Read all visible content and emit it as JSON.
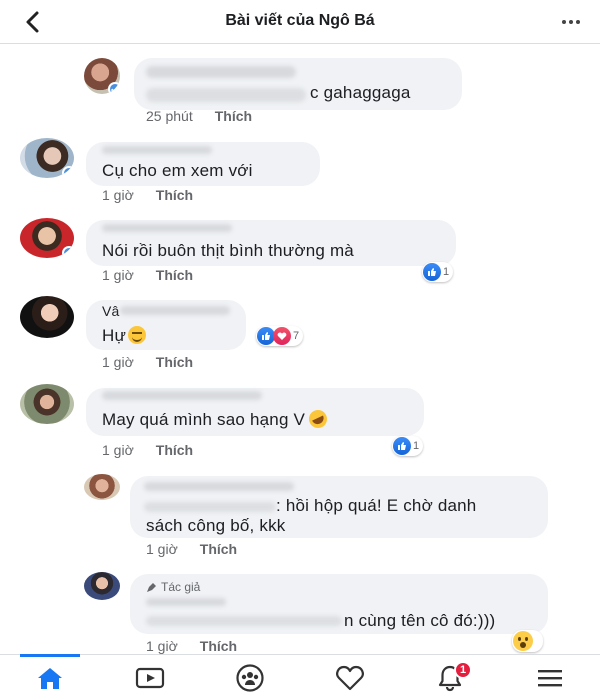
{
  "header": {
    "title": "Bài viết của Ngô Bá"
  },
  "comments": [
    {
      "text": "c gahaggaga",
      "time": "25 phút",
      "like": "Thích"
    },
    {
      "text": "Cụ cho em xem với",
      "time": "1 giờ",
      "like": "Thích"
    },
    {
      "text": "Nói rồi buôn thịt bình thường mà",
      "time": "1 giờ",
      "like": "Thích",
      "reaction_count": "1"
    },
    {
      "name_prefix": "Vâ",
      "text": "Hự",
      "time": "1 giờ",
      "like": "Thích",
      "reaction_count": "7"
    },
    {
      "text": "May quá mình sao hạng V",
      "time": "1 giờ",
      "like": "Thích",
      "reaction_count": "1"
    },
    {
      "text_line1": ": hồi hộp quá! E chờ danh",
      "text_line2": "sách công bố, kkk",
      "time": "1 giờ",
      "like": "Thích"
    },
    {
      "author_tag": "Tác giả",
      "text": "n cùng tên cô đó:)))",
      "time": "1 giờ",
      "like": "Thích"
    }
  ],
  "nav": {
    "notification_count": "1"
  },
  "colors": {
    "accent": "#1877f2",
    "bubble": "#f0f2f5",
    "meta": "#65676b",
    "badge": "#e41e3f"
  }
}
